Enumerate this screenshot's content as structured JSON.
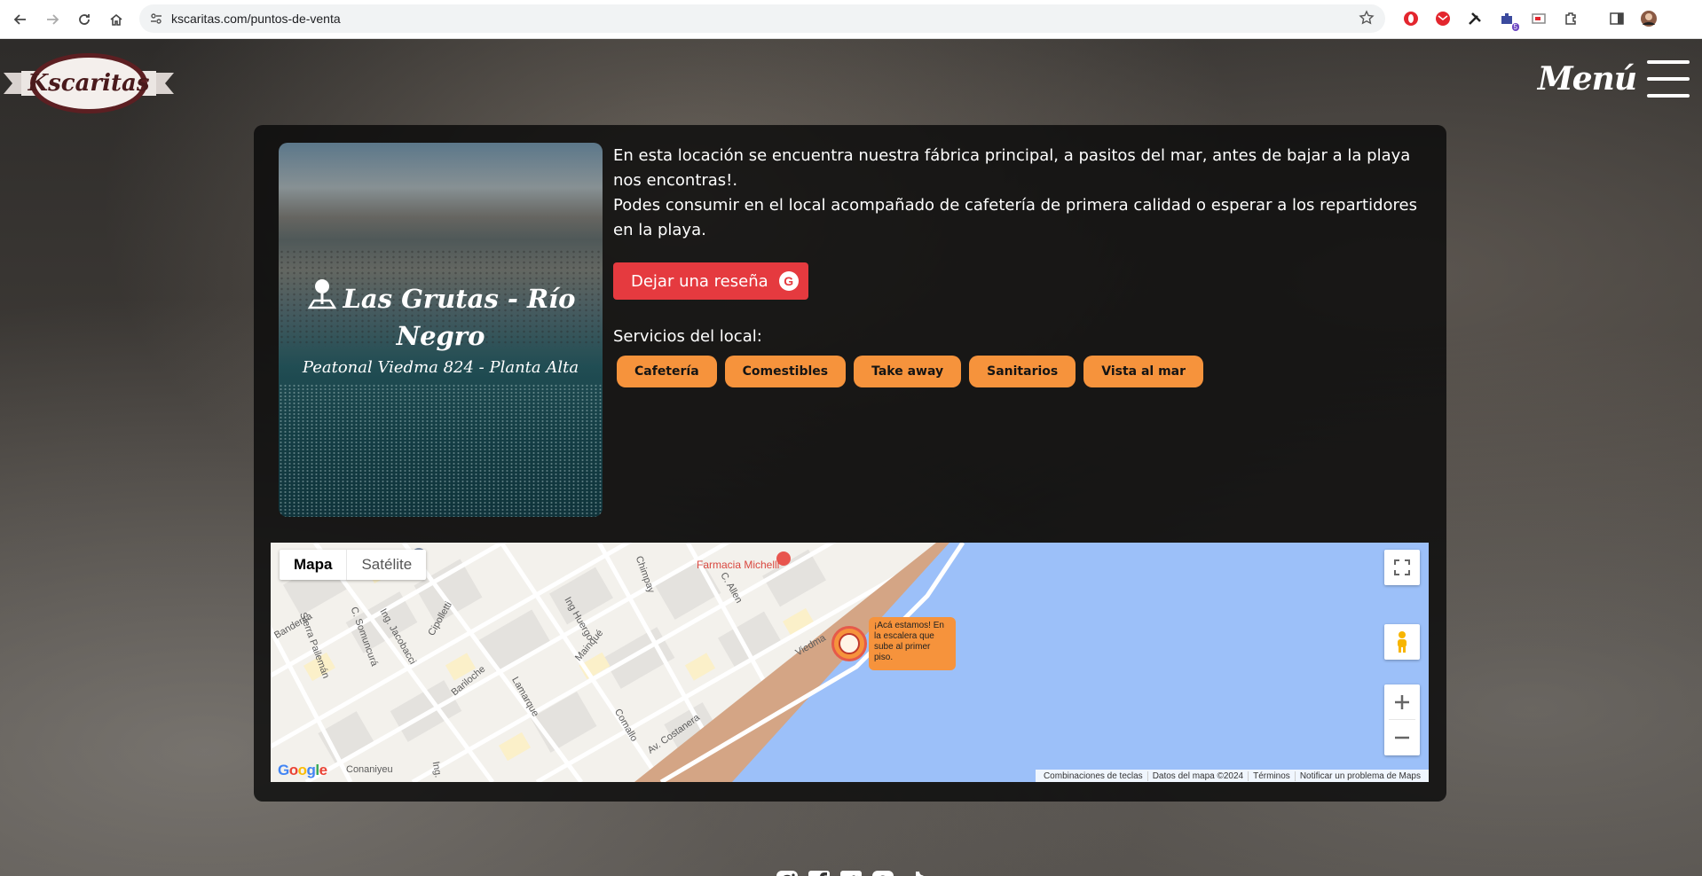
{
  "browser": {
    "url": "kscaritas.com/puntos-de-venta",
    "extension_badge": "5"
  },
  "header": {
    "logo_text": "Kscaritas",
    "menu_label": "Menú"
  },
  "location": {
    "title": "Las Grutas - Río Negro",
    "address": "Peatonal Viedma 824 - Planta Alta",
    "description_1": "En esta locación se encuentra nuestra fábrica principal, a pasitos del mar, antes de bajar a la playa nos encontras!.",
    "description_2": "Podes consumir en el local acompañado de cafetería de primera calidad o esperar a los repartidores en la playa.",
    "review_button": "Dejar una reseña",
    "services_label": "Servicios del local:",
    "services": [
      "Cafetería",
      "Comestibles",
      "Take away",
      "Sanitarios",
      "Vista al mar"
    ]
  },
  "map": {
    "type_map": "Mapa",
    "type_satellite": "Satélite",
    "poi_pharmacy": "Farmacia Michelli",
    "marker_tooltip": "¡Acá estamos! En la escalera que sube al primer piso.",
    "streets": [
      "Sierra Pailemán",
      "Banderita",
      "C. Somuncurá",
      "Ing. Jacobacci",
      "Cipolletti",
      "Bariloche",
      "Lamarque",
      "Mainqué",
      "Chimpay",
      "C. Allen",
      "Viedma",
      "Ing Huergo",
      "Comallo",
      "Av. Costanera",
      "Conaniyeu",
      "Ing."
    ],
    "google_logo": "Google",
    "attribution": [
      "Combinaciones de teclas",
      "Datos del mapa ©2024",
      "Términos",
      "Notificar un problema de Maps"
    ]
  },
  "social": [
    "instagram-icon",
    "facebook-icon",
    "twitter-icon",
    "threads-icon",
    "tiktok-icon"
  ],
  "colors": {
    "accent_orange": "#f6933c",
    "review_red": "#e53a3f",
    "sea_blue": "#9cc0f9",
    "sand": "#d4a585"
  }
}
